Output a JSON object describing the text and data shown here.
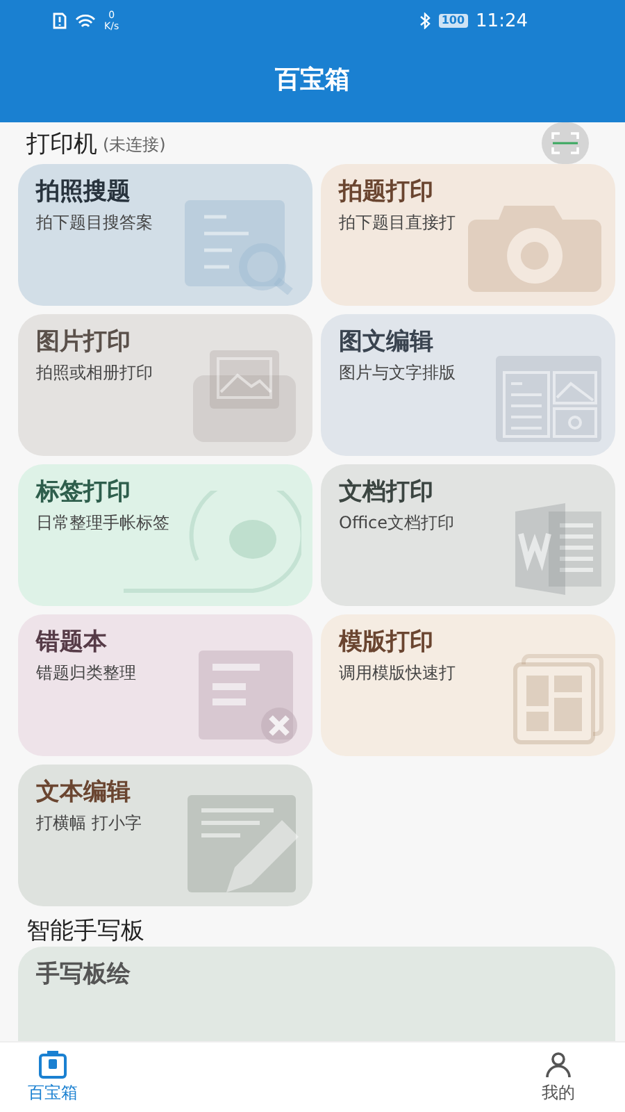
{
  "status_bar": {
    "net_speed_value": "0",
    "net_speed_unit": "K/s",
    "battery": "100",
    "time": "11:24"
  },
  "header": {
    "title": "百宝箱"
  },
  "printer": {
    "title": "打印机",
    "status": "(未连接)"
  },
  "tools": [
    {
      "title": "拍照搜题",
      "subtitle": "拍下题目搜答案",
      "color": "#d2dee7"
    },
    {
      "title": "拍题打印",
      "subtitle": "拍下题目直接打",
      "color": "#f3e8de"
    },
    {
      "title": "图片打印",
      "subtitle": "拍照或相册打印",
      "color": "#e4e2e0"
    },
    {
      "title": "图文编辑",
      "subtitle": "图片与文字排版",
      "color": "#e0e5eb"
    },
    {
      "title": "标签打印",
      "subtitle": "日常整理手帐标签",
      "color": "#def2e7"
    },
    {
      "title": "文档打印",
      "subtitle": "Office文档打印",
      "color": "#e1e3e1"
    },
    {
      "title": "错题本",
      "subtitle": "错题归类整理",
      "color": "#eee3e9"
    },
    {
      "title": "模版打印",
      "subtitle": "调用模版快速打",
      "color": "#f5ece2"
    },
    {
      "title": "文本编辑",
      "subtitle": "打横幅 打小字",
      "color": "#dee2de"
    }
  ],
  "handwriting": {
    "title": "智能手写板",
    "cards": [
      {
        "title": "手写板绘",
        "color": "#e1e8e3"
      }
    ]
  },
  "bottom_nav": [
    {
      "label": "百宝箱",
      "selected": true
    },
    {
      "label": "我的",
      "selected": false
    }
  ]
}
